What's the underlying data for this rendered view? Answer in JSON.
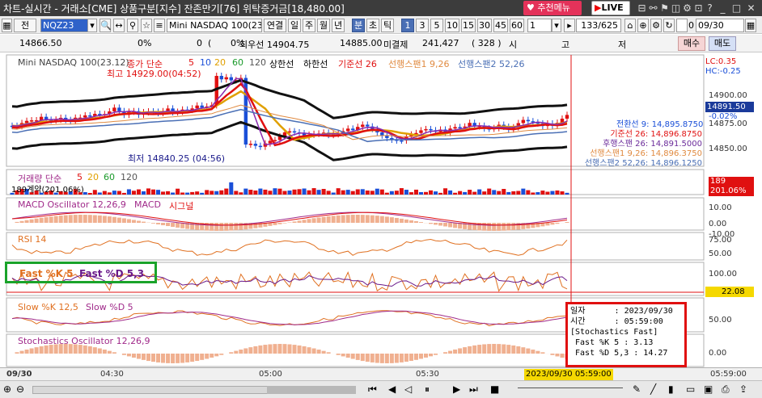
{
  "window": {
    "title": "차트-실시간 - 거래소[CME] 상품구분[지수] 잔존만기[76] 위탁증거금[18,480.00]",
    "recommend_label": "추천메뉴",
    "live_label": "LIVE"
  },
  "toolbar": {
    "tab_label": "전",
    "symbol_code": "NQZ23",
    "symbol_name": "Mini NASDAQ 100(23.1",
    "periods": [
      "연결",
      "일",
      "주",
      "월",
      "년",
      "분",
      "초",
      "틱"
    ],
    "selected_period": "분",
    "minutes": [
      "1",
      "3",
      "5",
      "10",
      "15",
      "30",
      "45",
      "60"
    ],
    "selected_minute": "1",
    "count": "1",
    "range": "133/625",
    "date": "09/30",
    "check_label": "0"
  },
  "quote": {
    "price": "14866.50",
    "pct": "0%",
    "zero": "0",
    "pct2": "0%",
    "best_bid": "최우선 14904.75",
    "best_ask": "14885.00",
    "open_int_label": "미결제",
    "open_int": "241,427",
    "open_int_chg": "( 328 )",
    "hl": "시",
    "ko": "고",
    "jeo": "저",
    "buy": "매수",
    "sell": "매도"
  },
  "price_panel": {
    "series": "Mini NASDAQ 100(23.12)",
    "ma_label": "종가 단순",
    "ma_periods": [
      "5",
      "10",
      "20",
      "60",
      "120"
    ],
    "sang": "상한선",
    "ha": "하한선",
    "base": "기준선 26",
    "lead1": "선행스팬1 9,26",
    "lead2": "선행스팬2 52,26",
    "high": "최고 14929.00(04:52)",
    "low": "최저 14840.25 (04:56)",
    "lc": "LC:0.35",
    "hc": "HC:-0.25",
    "price_tag": "14891.50",
    "pct_tag": "-0.02%",
    "legend": [
      "전환선 9: 14,895.8750",
      "기준선 26: 14,896.8750",
      "후행스팬 26: 14,891.5000",
      "선행스팬1 9,26: 14,896.3750",
      "선행스팬2 52,26: 14,896.1250"
    ],
    "ticks": [
      "14900.00",
      "14875.00",
      "14850.00"
    ]
  },
  "volume_panel": {
    "title": "거래량 단순",
    "periods": [
      "5",
      "20",
      "60",
      "120"
    ],
    "sub": "189계약(201.06%)",
    "tag1": "189",
    "tag2": "201.06%"
  },
  "macd_panel": {
    "title": "MACD Oscillator 12,26,9",
    "macd": "MACD",
    "signal": "시그널",
    "ticks": [
      "10.00",
      "0.00",
      "-10.00"
    ]
  },
  "rsi_panel": {
    "title": "RSI 14",
    "ticks": [
      "75.00",
      "50.00"
    ]
  },
  "fast_panel": {
    "k": "Fast %K 5",
    "d": "Fast %D 5,3",
    "ticks": [
      "100.00",
      "50.00"
    ],
    "tag": "22.08"
  },
  "slow_panel": {
    "k": "Slow %K 12,5",
    "d": "Slow %D 5",
    "ticks": [
      "50.00"
    ]
  },
  "stoch_panel": {
    "title": "Stochastics Oscillator 12,26,9",
    "ticks": [
      "0.00"
    ]
  },
  "xaxis": {
    "labels": [
      "09/30",
      "04:30",
      "05:00",
      "05:30"
    ],
    "cursor": "2023/09/30 05:59:00",
    "right": "05:59:00"
  },
  "tooltip": {
    "date": "일자      : 2023/09/30",
    "time": "시간      : 05:59:00",
    "name": "[Stochastics Fast]",
    "k": " Fast %K 5 : 3.13",
    "d": " Fast %D 5,3 : 14.27"
  },
  "colors": {
    "up": "#e01010",
    "down": "#1a4fd8",
    "accent": "#e01010",
    "green_box": "#1aa32a"
  }
}
